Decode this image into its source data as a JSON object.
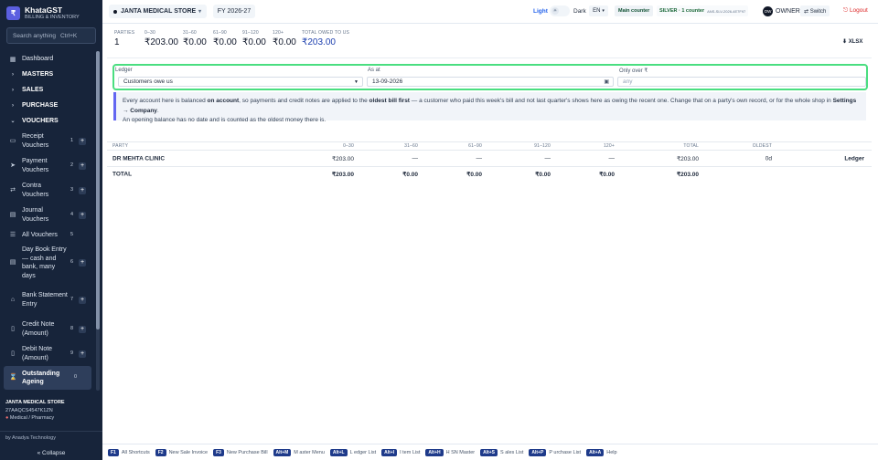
{
  "app": {
    "brand_name": "KhataGST",
    "brand_sub": "BILLING & INVENTORY",
    "logo_glyph": "₹",
    "search_placeholder": "Search anything",
    "search_shortcut": "Ctrl+K"
  },
  "sidebar": {
    "dashboard": "Dashboard",
    "sections": [
      "MASTERS",
      "SALES",
      "PURCHASE",
      "VOUCHERS"
    ],
    "vouchers": [
      {
        "label": "Receipt Vouchers",
        "num": "1",
        "plus": "+"
      },
      {
        "label": "Payment Vouchers",
        "num": "2",
        "plus": "+"
      },
      {
        "label": "Contra Vouchers",
        "num": "3",
        "plus": "+"
      },
      {
        "label": "Journal Vouchers",
        "num": "4",
        "plus": "+"
      },
      {
        "label": "All Vouchers",
        "num": "5",
        "plus": ""
      },
      {
        "label": "Day Book Entry — cash and bank, many days",
        "num": "6",
        "plus": "+"
      },
      {
        "label": "Bank Statement Entry",
        "num": "7",
        "plus": "+"
      },
      {
        "label": "Credit Note (Amount)",
        "num": "8",
        "plus": "+"
      },
      {
        "label": "Debit Note (Amount)",
        "num": "9",
        "plus": "+"
      },
      {
        "label": "Outstanding Ageing",
        "num": "0",
        "plus": ""
      }
    ],
    "store_name": "JANTA MEDICAL STORE",
    "gstin": "27AAQCS4547K1ZN",
    "store_type": "Medical / Pharmacy",
    "by_line": "by Anadya Technology",
    "collapse": "« Collapse"
  },
  "topbar": {
    "store": "JANTA MEDICAL STORE",
    "fy": "FY 2026-27",
    "light": "Light",
    "dark": "Dark",
    "lang": "EN",
    "main_counter": "Main counter",
    "plan": "SILVER · 1 counter",
    "plan_key": "ANS-SLV-2026-4E7F97",
    "owner_initials": "OW",
    "owner": "OWNER",
    "switch": "⇄ Switch",
    "logout": "⎋ Logout"
  },
  "summary": {
    "stats": [
      {
        "h": "PARTIES",
        "v": "1"
      },
      {
        "h": "0–30",
        "v": "₹203.00"
      },
      {
        "h": "31–60",
        "v": "₹0.00"
      },
      {
        "h": "61–90",
        "v": "₹0.00"
      },
      {
        "h": "91–120",
        "v": "₹0.00"
      },
      {
        "h": "120+",
        "v": "₹0.00"
      },
      {
        "h": "TOTAL OWED TO US",
        "v": "₹203.00"
      }
    ],
    "export": "⬇ XLSX"
  },
  "filters": {
    "ledger_label": "Ledger",
    "ledger_value": "Customers owe us",
    "as_at_label": "As at",
    "as_at_value": "13-09-2026",
    "only_over_label": "Only over ₹",
    "only_over_placeholder": "any"
  },
  "info": {
    "line1_a": "Every account here is balanced ",
    "line1_b": "on account",
    "line1_c": ", so payments and credit notes are applied to the ",
    "line1_d": "oldest bill first",
    "line1_e": " — a customer who paid this week's bill and not last quarter's shows here as owing the recent one. Change that on a party's own record, or for the whole shop in ",
    "line1_f": "Settings → Company",
    "line1_g": ".",
    "line2": "An opening balance has no date and is counted as the oldest money there is."
  },
  "table": {
    "headers": [
      "PARTY",
      "0–30",
      "31–60",
      "61–90",
      "91–120",
      "120+",
      "TOTAL",
      "OLDEST"
    ],
    "row": {
      "party": "DR MEHTA CLINIC",
      "d0": "₹203.00",
      "d31": "—",
      "d61": "—",
      "d91": "—",
      "d120": "—",
      "total": "₹203.00",
      "oldest": "0d",
      "action": "Ledger"
    },
    "total": {
      "label": "TOTAL",
      "d0": "₹203.00",
      "d31": "₹0.00",
      "d61": "₹0.00",
      "d91": "₹0.00",
      "d120": "₹0.00",
      "total": "₹203.00"
    }
  },
  "shortcuts": [
    {
      "key": "F1",
      "label": "All Shortcuts"
    },
    {
      "key": "F2",
      "label": "New Sale Invoice"
    },
    {
      "key": "F3",
      "label": "New Purchase Bill"
    },
    {
      "key": "Alt+M",
      "label": "M aster Menu"
    },
    {
      "key": "Alt+L",
      "label": "L edger List"
    },
    {
      "key": "Alt+I",
      "label": "I tem List"
    },
    {
      "key": "Alt+H",
      "label": "H SN Master"
    },
    {
      "key": "Alt+S",
      "label": "S ales List"
    },
    {
      "key": "Alt+P",
      "label": "P urchase List"
    },
    {
      "key": "Alt+A",
      "label": "Help"
    }
  ]
}
